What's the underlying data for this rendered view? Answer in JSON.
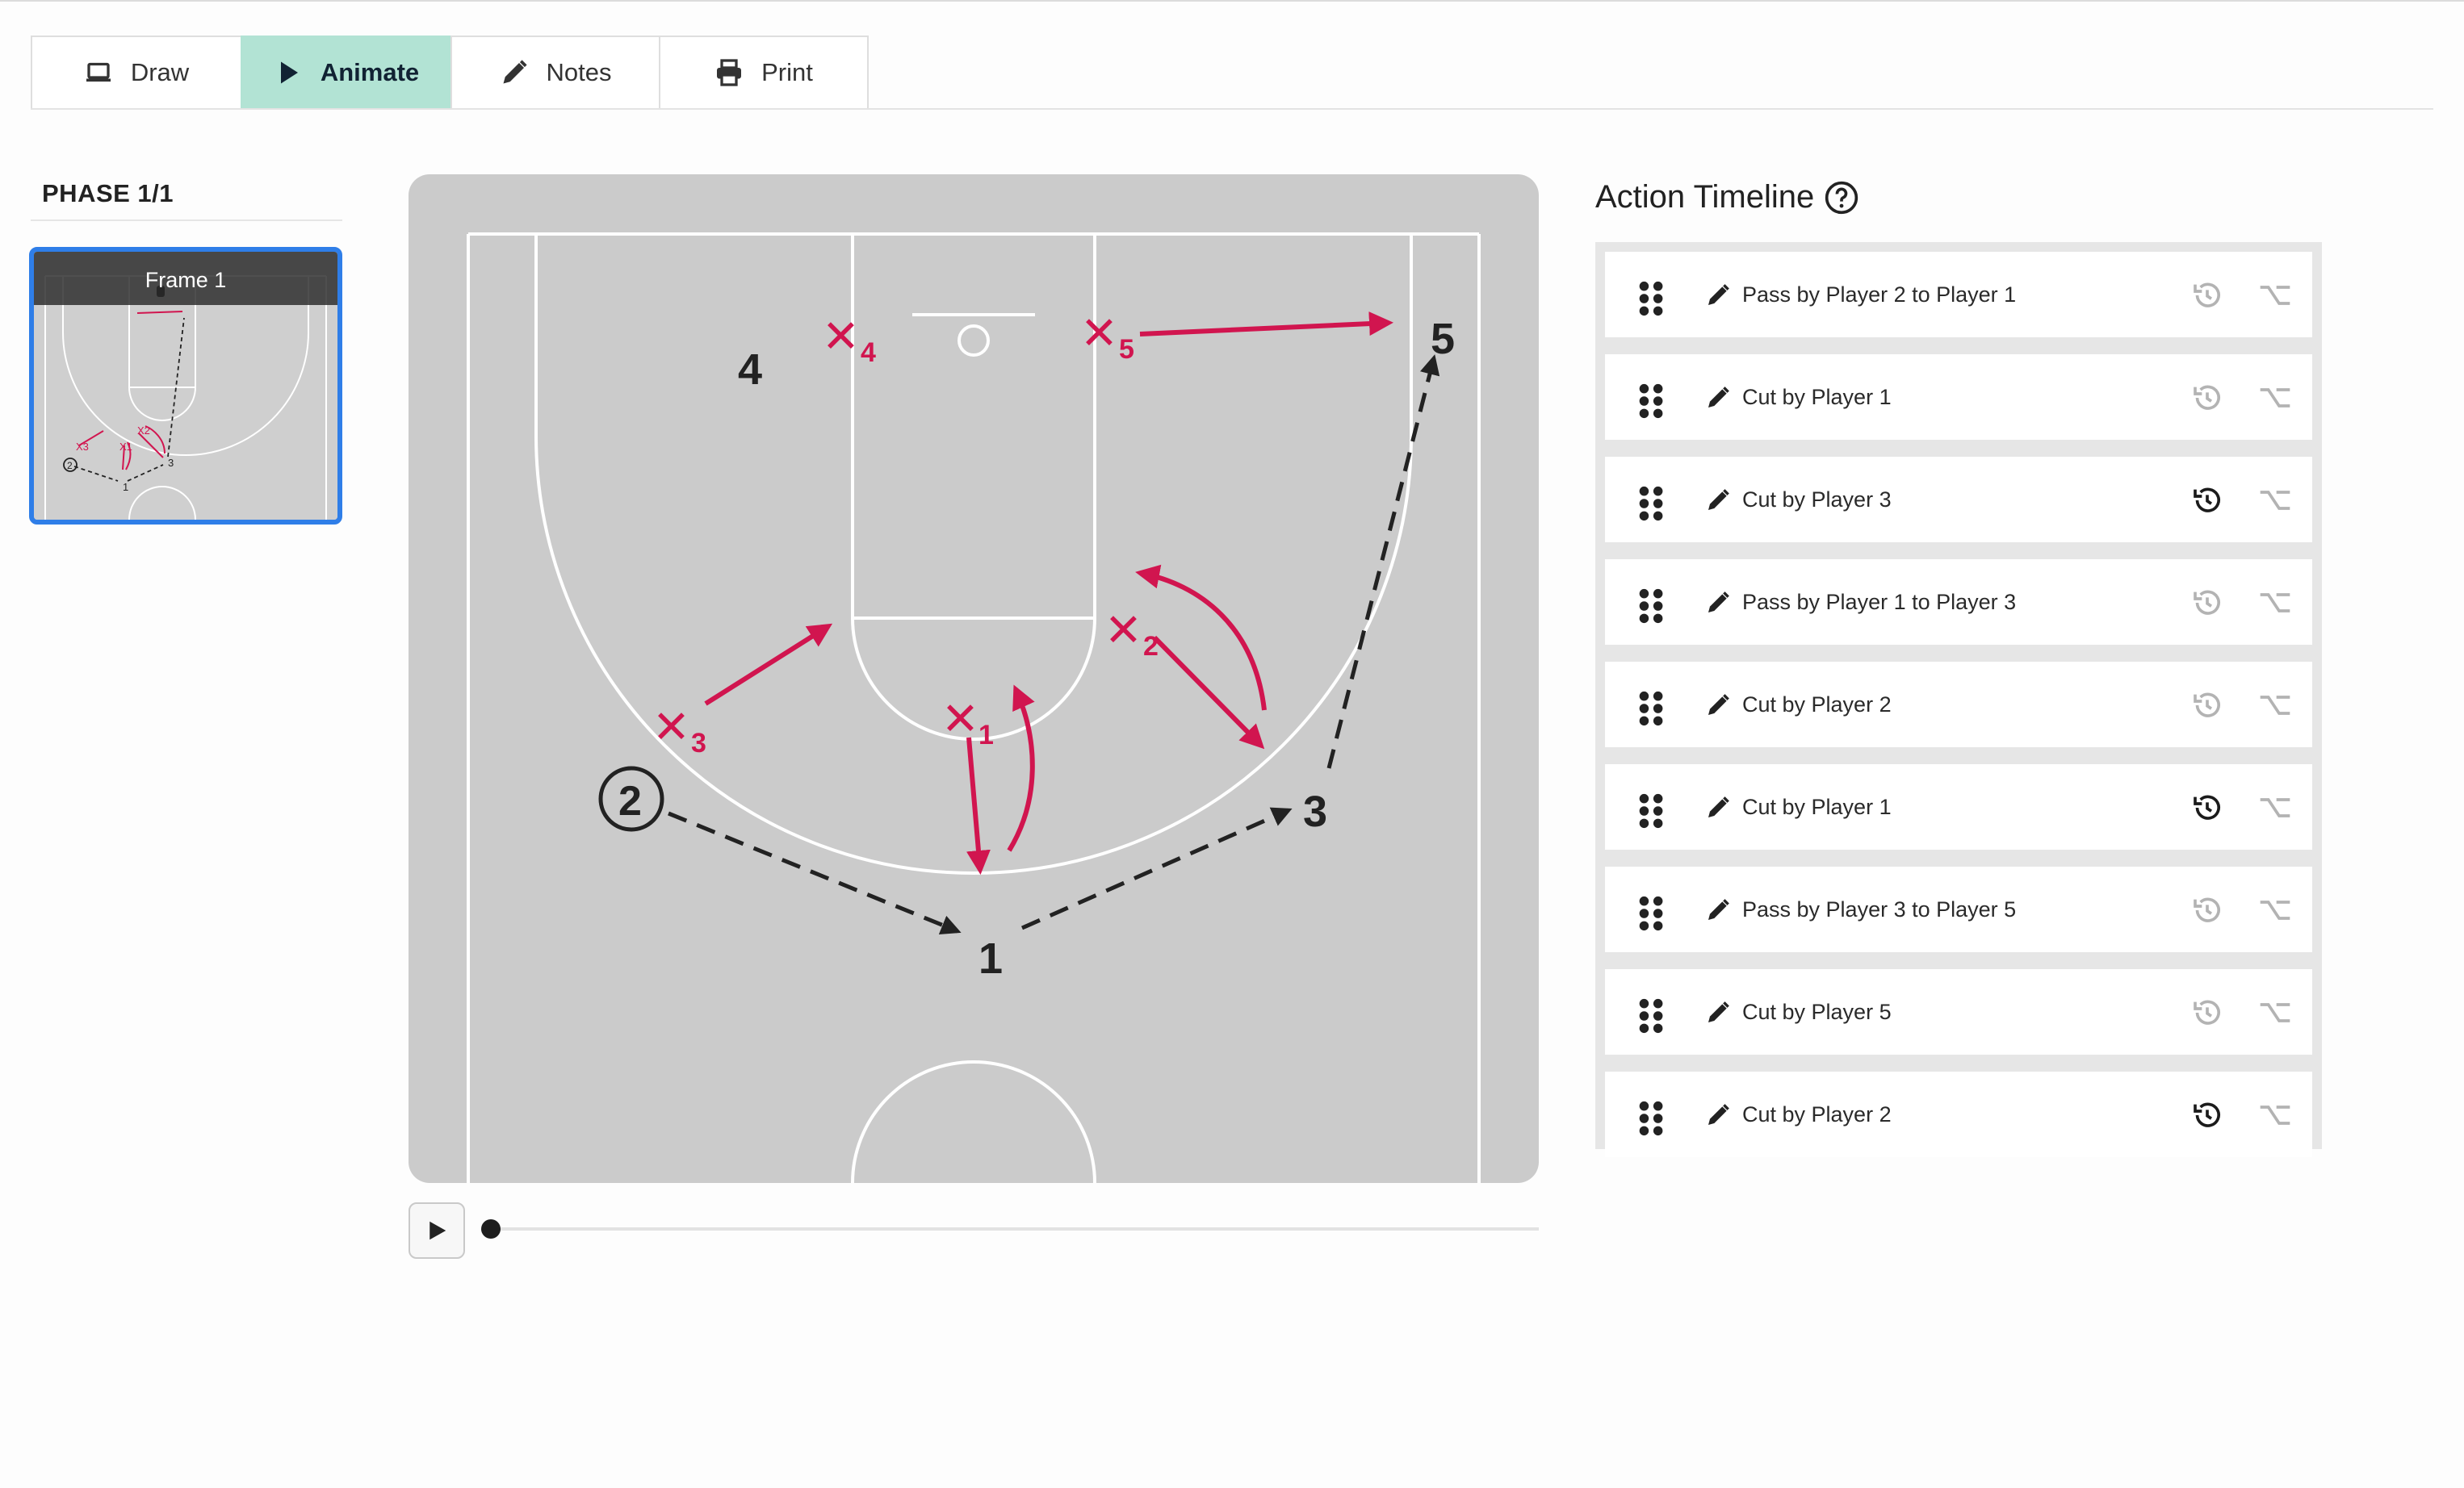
{
  "tabs": [
    {
      "label": "Draw",
      "icon": "laptop-icon",
      "active": false
    },
    {
      "label": "Animate",
      "icon": "play-icon",
      "active": true
    },
    {
      "label": "Notes",
      "icon": "pencil-icon",
      "active": false
    },
    {
      "label": "Print",
      "icon": "printer-icon",
      "active": false
    }
  ],
  "phase": {
    "label": "PHASE 1/1",
    "frame_title": "Frame 1"
  },
  "court": {
    "offense": [
      "1",
      "2",
      "3",
      "4",
      "5"
    ],
    "defense": [
      "1",
      "2",
      "3",
      "4",
      "5"
    ],
    "colors": {
      "defense": "#d1154f",
      "offense": "#222222",
      "court": "#cbcbcb",
      "lines": "#ffffff"
    }
  },
  "playback": {
    "progress": 0
  },
  "timeline": {
    "title": "Action Timeline",
    "actions": [
      {
        "label": "Pass by Player 2 to Player 1",
        "history_active": false
      },
      {
        "label": "Cut by Player 1",
        "history_active": false
      },
      {
        "label": "Cut by Player 3",
        "history_active": true
      },
      {
        "label": "Pass by Player 1 to Player 3",
        "history_active": false
      },
      {
        "label": "Cut by Player 2",
        "history_active": false
      },
      {
        "label": "Cut by Player 1",
        "history_active": true
      },
      {
        "label": "Pass by Player 3 to Player 5",
        "history_active": false
      },
      {
        "label": "Cut by Player 5",
        "history_active": false
      },
      {
        "label": "Cut by Player 2",
        "history_active": true
      }
    ]
  }
}
